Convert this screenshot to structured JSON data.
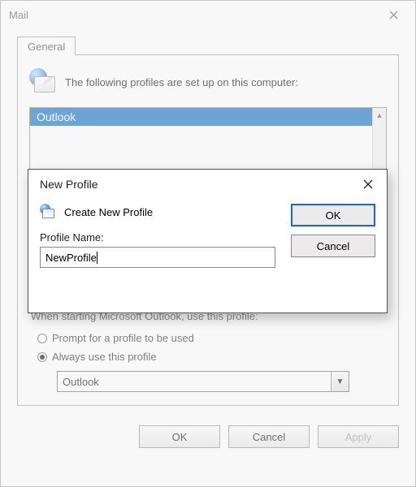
{
  "mail": {
    "title": "Mail",
    "tab_general": "General",
    "intro": "The following profiles are set up on this computer:",
    "profiles": [
      "Outlook"
    ],
    "when_label": "When starting Microsoft Outlook, use this profile:",
    "radio_prompt": "Prompt for a profile to be used",
    "radio_always": "Always use this profile",
    "selected_profile": "Outlook",
    "ok": "OK",
    "cancel": "Cancel",
    "apply": "Apply"
  },
  "dialog": {
    "title": "New Profile",
    "heading": "Create New Profile",
    "name_label": "Profile Name:",
    "name_value": "NewProfile",
    "ok": "OK",
    "cancel": "Cancel"
  }
}
